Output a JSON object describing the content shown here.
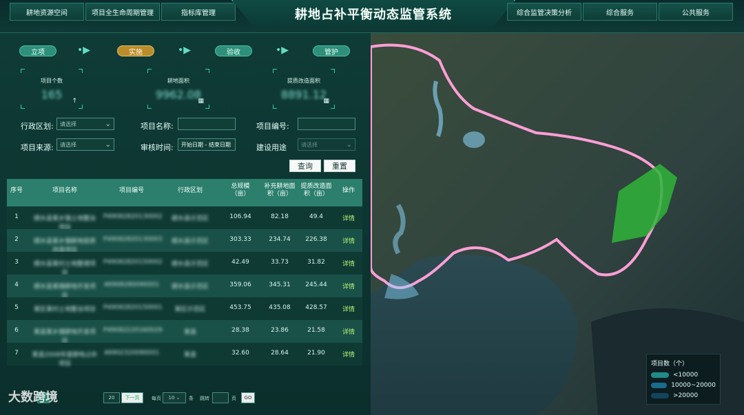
{
  "header": {
    "title": "耕地占补平衡动态监管系统",
    "nav_left": [
      "耕地资源空间",
      "项目全生命周期管理",
      "指标库管理"
    ],
    "nav_right": [
      "综合监管决策分析",
      "综合服务",
      "公共服务"
    ]
  },
  "stages": [
    "立项",
    "实施",
    "验收",
    "管护"
  ],
  "stats": [
    {
      "label": "项目个数",
      "value": "165",
      "icon": "arrow-up-icon"
    },
    {
      "label": "耕地面积",
      "value": "9962.08",
      "icon": "grid-icon"
    },
    {
      "label": "提质改造面积",
      "value": "8891.12",
      "icon": "grid-icon"
    }
  ],
  "form": {
    "region_label": "行政区划:",
    "region_placeholder": "请选择",
    "name_label": "项目名称:",
    "code_label": "项目编号:",
    "source_label": "项目来源:",
    "source_placeholder": "请选择",
    "audit_label": "审核时间:",
    "date_start": "开始日期",
    "date_sep": "-",
    "date_end": "结束日期",
    "use_label": "建设用途",
    "use_placeholder": "请选择",
    "query": "查询",
    "reset": "重置"
  },
  "table": {
    "headers": [
      "序号",
      "项目名称",
      "项目编号",
      "行政区划",
      "总规模\n（亩）",
      "补充耕地面\n积（亩）",
      "提质改造面\n积（亩）",
      "操作"
    ],
    "rows": [
      {
        "no": "1",
        "name": "顺水县某乡镇土地整治项目",
        "code": "P49082820130002",
        "region": "顺水县示范区",
        "total": "106.94",
        "supplement": "82.18",
        "upgrade": "49.4",
        "op": "详情"
      },
      {
        "no": "2",
        "name": "顺水县某乡镇耕地提质改造项目",
        "code": "P49082820130003",
        "region": "顺水县示范区",
        "total": "303.33",
        "supplement": "234.74",
        "upgrade": "226.38",
        "op": "详情"
      },
      {
        "no": "3",
        "name": "顺水县某村土地整理项目",
        "code": "P49082820150002",
        "region": "顺水县示范区",
        "total": "42.49",
        "supplement": "33.73",
        "upgrade": "31.82",
        "op": "详情"
      },
      {
        "no": "4",
        "name": "顺水县某镇耕地开发项目",
        "code": "46908280090001",
        "region": "顺水县示范区",
        "total": "359.06",
        "supplement": "345.31",
        "upgrade": "245.44",
        "op": "详情"
      },
      {
        "no": "5",
        "name": "某区某村土地整治项目",
        "code": "P49082820150001",
        "region": "某区示范区",
        "total": "453.75",
        "supplement": "435.08",
        "upgrade": "428.57",
        "op": "详情"
      },
      {
        "no": "6",
        "name": "某县某乡镇耕地开发项目",
        "code": "P49082220160029",
        "region": "某县",
        "total": "28.38",
        "supplement": "23.86",
        "upgrade": "21.58",
        "op": "详情"
      },
      {
        "no": "7",
        "name": "某县2008年度耕地占补项目",
        "code": "46902320090001",
        "region": "某县",
        "total": "32.60",
        "supplement": "28.64",
        "upgrade": "21.90",
        "op": "详情"
      }
    ]
  },
  "pager": {
    "pages": [
      "1",
      "20"
    ],
    "next": "下一页",
    "per_page_label": "每页",
    "per_page": "10",
    "unit": "条",
    "jump_label": "跳转",
    "page_unit": "页",
    "go": "GO"
  },
  "map": {
    "legend_title": "项目数（个）",
    "legend": [
      {
        "label": "<10000",
        "color": "#1f8c8a"
      },
      {
        "label": "10000~20000",
        "color": "#1a6c8c"
      },
      {
        "label": ">20000",
        "color": "#13445c"
      }
    ],
    "boundary_color": "#ff9fd6",
    "highlight_color": "#2fb43a"
  },
  "watermark": "大数跨境"
}
